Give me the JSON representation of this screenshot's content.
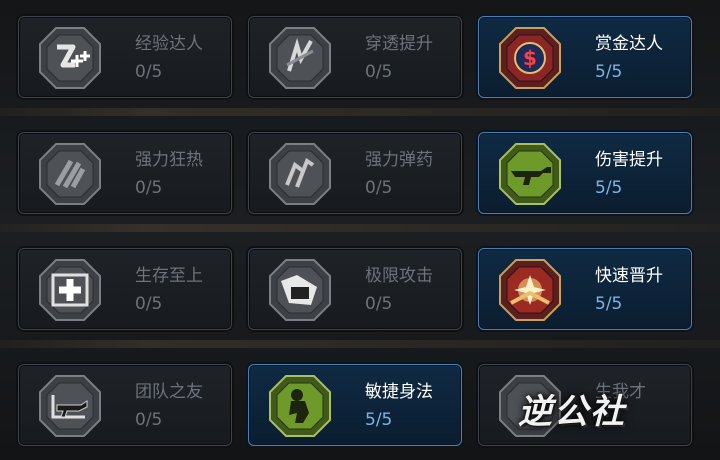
{
  "perks": [
    {
      "name": "经验达人",
      "progress": "0/5",
      "active": false,
      "icon": "xp-plus-icon"
    },
    {
      "name": "穿透提升",
      "progress": "0/5",
      "active": false,
      "icon": "penetration-icon"
    },
    {
      "name": "赏金达人",
      "progress": "5/5",
      "active": true,
      "icon": "dollar-coin-icon"
    },
    {
      "name": "强力狂热",
      "progress": "0/5",
      "active": false,
      "icon": "power-frenzy-icon"
    },
    {
      "name": "强力弹药",
      "progress": "0/5",
      "active": false,
      "icon": "power-ammo-icon"
    },
    {
      "name": "伤害提升",
      "progress": "5/5",
      "active": true,
      "icon": "rifle-icon"
    },
    {
      "name": "生存至上",
      "progress": "0/5",
      "active": false,
      "icon": "medical-cross-icon"
    },
    {
      "name": "极限攻击",
      "progress": "0/5",
      "active": false,
      "icon": "extreme-attack-icon"
    },
    {
      "name": "快速晋升",
      "progress": "5/5",
      "active": true,
      "icon": "rank-star-icon"
    },
    {
      "name": "团队之友",
      "progress": "0/5",
      "active": false,
      "icon": "team-rifle-icon"
    },
    {
      "name": "敏捷身法",
      "progress": "5/5",
      "active": true,
      "icon": "agile-soldier-icon"
    },
    {
      "name": "生我才",
      "progress": "",
      "active": false,
      "icon": "locked-perk-icon"
    }
  ],
  "watermark": {
    "text": "逆公社"
  },
  "colors": {
    "active_border": "#4d7fae",
    "active_progress": "#7fb3e6",
    "inactive_text": "#6c737b"
  }
}
